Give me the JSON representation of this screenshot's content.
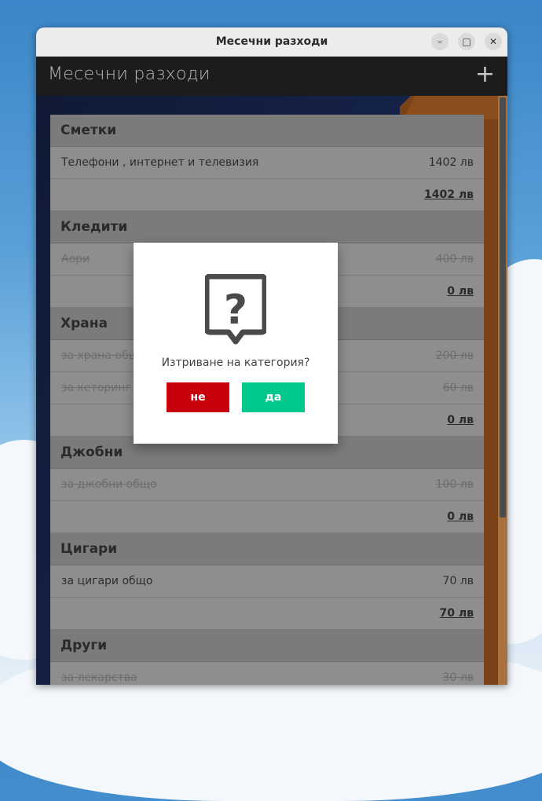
{
  "window": {
    "title": "Месечни разходи",
    "minimize": "–",
    "maximize": "□",
    "close": "✕"
  },
  "appbar": {
    "title": "Месечни разходи",
    "add_symbol": "+"
  },
  "categories": [
    {
      "name": "Сметки",
      "items": [
        {
          "label": "Телефони , интернет и телевизия",
          "amount": "1402 лв",
          "struck": false
        }
      ],
      "total": "1402 лв"
    },
    {
      "name": "Кледити",
      "items": [
        {
          "label": "Аори",
          "amount": "400 лв",
          "struck": true
        }
      ],
      "total": "0 лв"
    },
    {
      "name": "Храна",
      "items": [
        {
          "label": "за храна общо",
          "amount": "200 лв",
          "struck": true
        },
        {
          "label": "за кеторинг",
          "amount": "60 лв",
          "struck": true
        }
      ],
      "total": "0 лв"
    },
    {
      "name": "Джобни",
      "items": [
        {
          "label": "за джобни общо",
          "amount": "100 лв",
          "struck": true
        }
      ],
      "total": "0 лв"
    },
    {
      "name": "Цигари",
      "items": [
        {
          "label": "за цигари общо",
          "amount": "70 лв",
          "struck": false
        }
      ],
      "total": "70 лв"
    },
    {
      "name": "Други",
      "items": [
        {
          "label": "за лекарства",
          "amount": "30 лв",
          "struck": true
        }
      ],
      "total": ""
    }
  ],
  "dialog": {
    "message": "Изтриване на категория?",
    "no_label": "не",
    "yes_label": "да",
    "no_color": "#c8000c",
    "yes_color": "#00c88c"
  },
  "colors": {
    "appbar": "#1c1c1c",
    "accent_orange": "#7a4216"
  }
}
